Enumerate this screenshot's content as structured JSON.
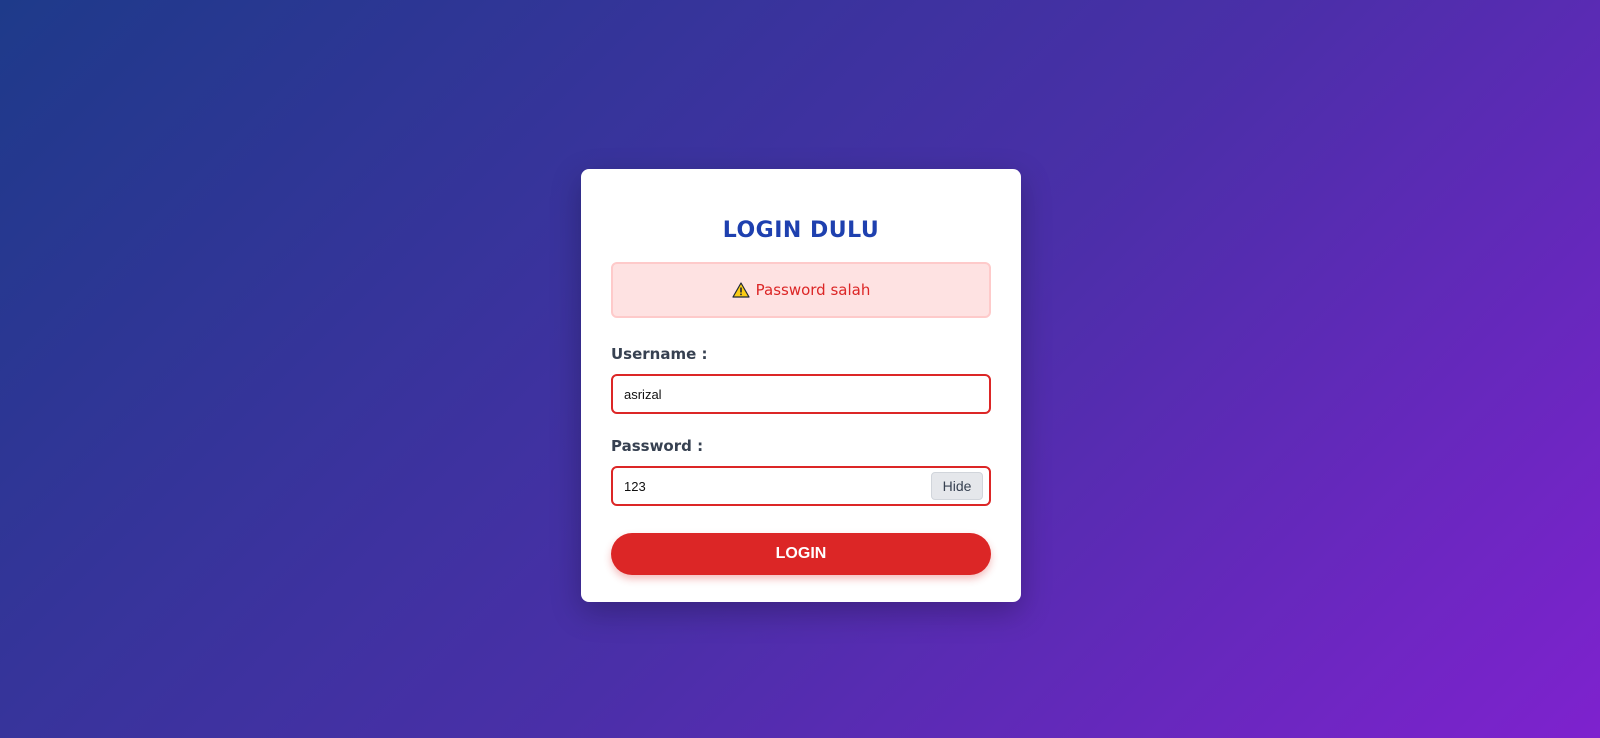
{
  "page": {
    "background_gradient": [
      "#1e3a8a",
      "#7e22ce"
    ]
  },
  "login_card": {
    "title": "LOGIN DULU",
    "alert": {
      "icon": "warning-icon",
      "message": "Password salah",
      "color": "#dc2626"
    },
    "username": {
      "label": "Username :",
      "value": "asrizal"
    },
    "password": {
      "label": "Password :",
      "value": "123",
      "toggle_label": "Hide"
    },
    "submit_label": "LOGIN",
    "accent_color": "#1e40af",
    "button_color": "#dc2626"
  }
}
